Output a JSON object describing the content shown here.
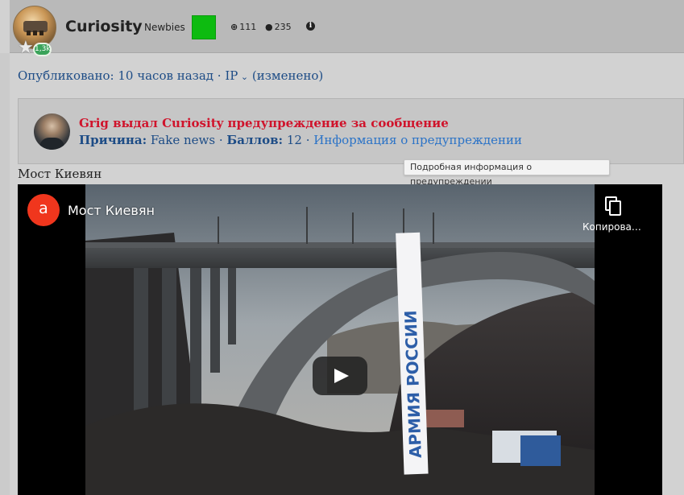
{
  "user": {
    "username": "Curiosity",
    "group": "Newbies",
    "reputation_badge": "1,3k",
    "status_color": "#0dbb10",
    "stats": [
      {
        "icon": "plus-circle-icon",
        "value": "111"
      },
      {
        "icon": "comment-icon",
        "value": "235"
      }
    ]
  },
  "post_meta": {
    "published_label": "Опубликовано:",
    "published_time": "10 часов назад",
    "separator": "·",
    "ip_label": "IP",
    "edited_label": "(изменено)"
  },
  "warning": {
    "title": "Grig выдал Curiosity предупреждение за сообщение",
    "reason_label": "Причина:",
    "reason_value": "Fake news",
    "points_label": "Баллов:",
    "points_value": "12",
    "info_link": "Информация о предупреждении",
    "separator": "·",
    "tooltip": "Подробная информация о предупреждении"
  },
  "post": {
    "title": "Мост Киевян"
  },
  "video": {
    "channel_letter": "a",
    "title": "Мост Киевян",
    "copy_label": "Копирова…",
    "banner_text": "АРМИЯ РОССИИ"
  }
}
